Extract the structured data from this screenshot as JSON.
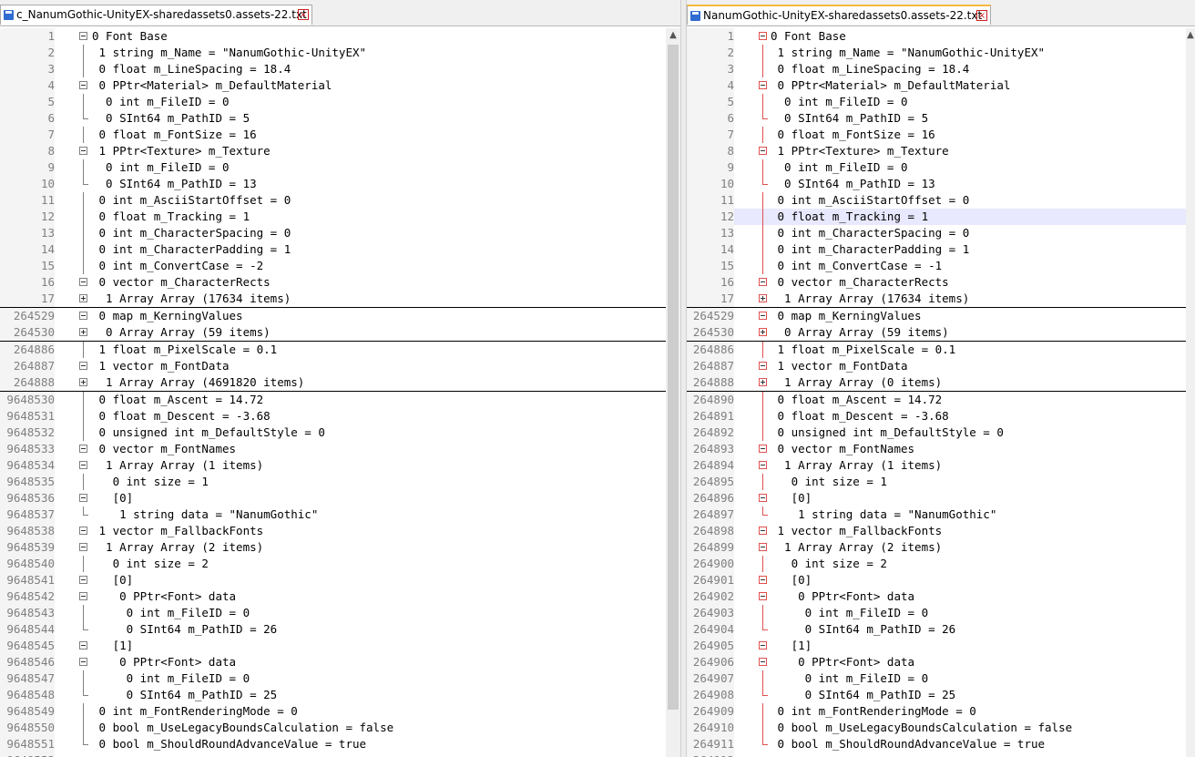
{
  "left": {
    "tab_title": "c_NanumGothic-UnityEX-sharedassets0.assets-22.txt",
    "lines": [
      {
        "n": "1",
        "t": "0 Font Base",
        "f": "minus"
      },
      {
        "n": "2",
        "t": " 1 string m_Name = \"NanumGothic-UnityEX\"",
        "f": "line"
      },
      {
        "n": "3",
        "t": " 0 float m_LineSpacing = 18.4",
        "f": "line"
      },
      {
        "n": "4",
        "t": " 0 PPtr<Material> m_DefaultMaterial",
        "f": "minus"
      },
      {
        "n": "5",
        "t": "  0 int m_FileID = 0",
        "f": "line"
      },
      {
        "n": "6",
        "t": "  0 SInt64 m_PathID = 5",
        "f": "end"
      },
      {
        "n": "7",
        "t": " 0 float m_FontSize = 16",
        "f": "line"
      },
      {
        "n": "8",
        "t": " 1 PPtr<Texture> m_Texture",
        "f": "minus"
      },
      {
        "n": "9",
        "t": "  0 int m_FileID = 0",
        "f": "line"
      },
      {
        "n": "10",
        "t": "  0 SInt64 m_PathID = 13",
        "f": "end"
      },
      {
        "n": "11",
        "t": " 0 int m_AsciiStartOffset = 0",
        "f": "line"
      },
      {
        "n": "12",
        "t": " 0 float m_Tracking = 1",
        "f": "line"
      },
      {
        "n": "13",
        "t": " 0 int m_CharacterSpacing = 0",
        "f": "line"
      },
      {
        "n": "14",
        "t": " 0 int m_CharacterPadding = 1",
        "f": "line"
      },
      {
        "n": "15",
        "t": " 0 int m_ConvertCase = -2",
        "f": "line"
      },
      {
        "n": "16",
        "t": " 0 vector m_CharacterRects",
        "f": "minus"
      },
      {
        "n": "17",
        "t": "  1 Array Array (17634 items)",
        "f": "plus",
        "sep": true
      },
      {
        "n": "264529",
        "t": " 0 map m_KerningValues",
        "f": "minus"
      },
      {
        "n": "264530",
        "t": "  0 Array Array (59 items)",
        "f": "plus",
        "sep": true
      },
      {
        "n": "264886",
        "t": " 1 float m_PixelScale = 0.1",
        "f": "line"
      },
      {
        "n": "264887",
        "t": " 1 vector m_FontData",
        "f": "minus"
      },
      {
        "n": "264888",
        "t": "  1 Array Array (4691820 items)",
        "f": "plus",
        "sep": true
      },
      {
        "n": "9648530",
        "t": " 0 float m_Ascent = 14.72",
        "f": "line"
      },
      {
        "n": "9648531",
        "t": " 0 float m_Descent = -3.68",
        "f": "line"
      },
      {
        "n": "9648532",
        "t": " 0 unsigned int m_DefaultStyle = 0",
        "f": "line"
      },
      {
        "n": "9648533",
        "t": " 0 vector m_FontNames",
        "f": "minus"
      },
      {
        "n": "9648534",
        "t": "  1 Array Array (1 items)",
        "f": "minus"
      },
      {
        "n": "9648535",
        "t": "   0 int size = 1",
        "f": "line"
      },
      {
        "n": "9648536",
        "t": "   [0]",
        "f": "minus"
      },
      {
        "n": "9648537",
        "t": "    1 string data = \"NanumGothic\"",
        "f": "end"
      },
      {
        "n": "9648538",
        "t": " 1 vector m_FallbackFonts",
        "f": "minus"
      },
      {
        "n": "9648539",
        "t": "  1 Array Array (2 items)",
        "f": "minus"
      },
      {
        "n": "9648540",
        "t": "   0 int size = 2",
        "f": "line"
      },
      {
        "n": "9648541",
        "t": "   [0]",
        "f": "minus"
      },
      {
        "n": "9648542",
        "t": "    0 PPtr<Font> data",
        "f": "minus"
      },
      {
        "n": "9648543",
        "t": "     0 int m_FileID = 0",
        "f": "line"
      },
      {
        "n": "9648544",
        "t": "     0 SInt64 m_PathID = 26",
        "f": "end"
      },
      {
        "n": "9648545",
        "t": "   [1]",
        "f": "minus"
      },
      {
        "n": "9648546",
        "t": "    0 PPtr<Font> data",
        "f": "minus"
      },
      {
        "n": "9648547",
        "t": "     0 int m_FileID = 0",
        "f": "line"
      },
      {
        "n": "9648548",
        "t": "     0 SInt64 m_PathID = 25",
        "f": "end"
      },
      {
        "n": "9648549",
        "t": " 0 int m_FontRenderingMode = 0",
        "f": "line"
      },
      {
        "n": "9648550",
        "t": " 0 bool m_UseLegacyBoundsCalculation = false",
        "f": "line"
      },
      {
        "n": "9648551",
        "t": " 0 bool m_ShouldRoundAdvanceValue = true",
        "f": "end"
      },
      {
        "n": "9648552",
        "t": "",
        "f": "none"
      }
    ]
  },
  "right": {
    "tab_title": "NanumGothic-UnityEX-sharedassets0.assets-22.txt",
    "lines": [
      {
        "n": "1",
        "t": "0 Font Base",
        "f": "minus"
      },
      {
        "n": "2",
        "t": " 1 string m_Name = \"NanumGothic-UnityEX\"",
        "f": "line"
      },
      {
        "n": "3",
        "t": " 0 float m_LineSpacing = 18.4",
        "f": "line"
      },
      {
        "n": "4",
        "t": " 0 PPtr<Material> m_DefaultMaterial",
        "f": "minus"
      },
      {
        "n": "5",
        "t": "  0 int m_FileID = 0",
        "f": "line"
      },
      {
        "n": "6",
        "t": "  0 SInt64 m_PathID = 5",
        "f": "end"
      },
      {
        "n": "7",
        "t": " 0 float m_FontSize = 16",
        "f": "line"
      },
      {
        "n": "8",
        "t": " 1 PPtr<Texture> m_Texture",
        "f": "minus"
      },
      {
        "n": "9",
        "t": "  0 int m_FileID = 0",
        "f": "line"
      },
      {
        "n": "10",
        "t": "  0 SInt64 m_PathID = 13",
        "f": "end"
      },
      {
        "n": "11",
        "t": " 0 int m_AsciiStartOffset = 0",
        "f": "line"
      },
      {
        "n": "12",
        "t": " 0 float m_Tracking = 1",
        "f": "line",
        "hl": true
      },
      {
        "n": "13",
        "t": " 0 int m_CharacterSpacing = 0",
        "f": "line"
      },
      {
        "n": "14",
        "t": " 0 int m_CharacterPadding = 1",
        "f": "line"
      },
      {
        "n": "15",
        "t": " 0 int m_ConvertCase = -1",
        "f": "line"
      },
      {
        "n": "16",
        "t": " 0 vector m_CharacterRects",
        "f": "minus"
      },
      {
        "n": "17",
        "t": "  1 Array Array (17634 items)",
        "f": "plus",
        "sep": true
      },
      {
        "n": "264529",
        "t": " 0 map m_KerningValues",
        "f": "minus"
      },
      {
        "n": "264530",
        "t": "  0 Array Array (59 items)",
        "f": "plus",
        "sep": true
      },
      {
        "n": "264886",
        "t": " 1 float m_PixelScale = 0.1",
        "f": "line"
      },
      {
        "n": "264887",
        "t": " 1 vector m_FontData",
        "f": "minus"
      },
      {
        "n": "264888",
        "t": "  1 Array Array (0 items)",
        "f": "plus",
        "sep": true
      },
      {
        "n": "264890",
        "t": " 0 float m_Ascent = 14.72",
        "f": "line"
      },
      {
        "n": "264891",
        "t": " 0 float m_Descent = -3.68",
        "f": "line"
      },
      {
        "n": "264892",
        "t": " 0 unsigned int m_DefaultStyle = 0",
        "f": "line"
      },
      {
        "n": "264893",
        "t": " 0 vector m_FontNames",
        "f": "minus"
      },
      {
        "n": "264894",
        "t": "  1 Array Array (1 items)",
        "f": "minus"
      },
      {
        "n": "264895",
        "t": "   0 int size = 1",
        "f": "line"
      },
      {
        "n": "264896",
        "t": "   [0]",
        "f": "minus"
      },
      {
        "n": "264897",
        "t": "    1 string data = \"NanumGothic\"",
        "f": "end"
      },
      {
        "n": "264898",
        "t": " 1 vector m_FallbackFonts",
        "f": "minus"
      },
      {
        "n": "264899",
        "t": "  1 Array Array (2 items)",
        "f": "minus"
      },
      {
        "n": "264900",
        "t": "   0 int size = 2",
        "f": "line"
      },
      {
        "n": "264901",
        "t": "   [0]",
        "f": "minus"
      },
      {
        "n": "264902",
        "t": "    0 PPtr<Font> data",
        "f": "minus"
      },
      {
        "n": "264903",
        "t": "     0 int m_FileID = 0",
        "f": "line"
      },
      {
        "n": "264904",
        "t": "     0 SInt64 m_PathID = 26",
        "f": "end"
      },
      {
        "n": "264905",
        "t": "   [1]",
        "f": "minus"
      },
      {
        "n": "264906",
        "t": "    0 PPtr<Font> data",
        "f": "minus"
      },
      {
        "n": "264907",
        "t": "     0 int m_FileID = 0",
        "f": "line"
      },
      {
        "n": "264908",
        "t": "     0 SInt64 m_PathID = 25",
        "f": "end"
      },
      {
        "n": "264909",
        "t": " 0 int m_FontRenderingMode = 0",
        "f": "line"
      },
      {
        "n": "264910",
        "t": " 0 bool m_UseLegacyBoundsCalculation = false",
        "f": "line"
      },
      {
        "n": "264911",
        "t": " 0 bool m_ShouldRoundAdvanceValue = true",
        "f": "end"
      },
      {
        "n": "264912",
        "t": "",
        "f": "none"
      }
    ]
  },
  "colors": {
    "highlight_line": "#e8e8ff",
    "fold_marker_right": "#e05050",
    "fold_marker_left": "#808080",
    "active_tab_accent": "#f5b942"
  },
  "icons": {
    "tab_save": "save-icon",
    "tab_close": "close-icon",
    "scroll_up": "chevron-up-icon"
  }
}
